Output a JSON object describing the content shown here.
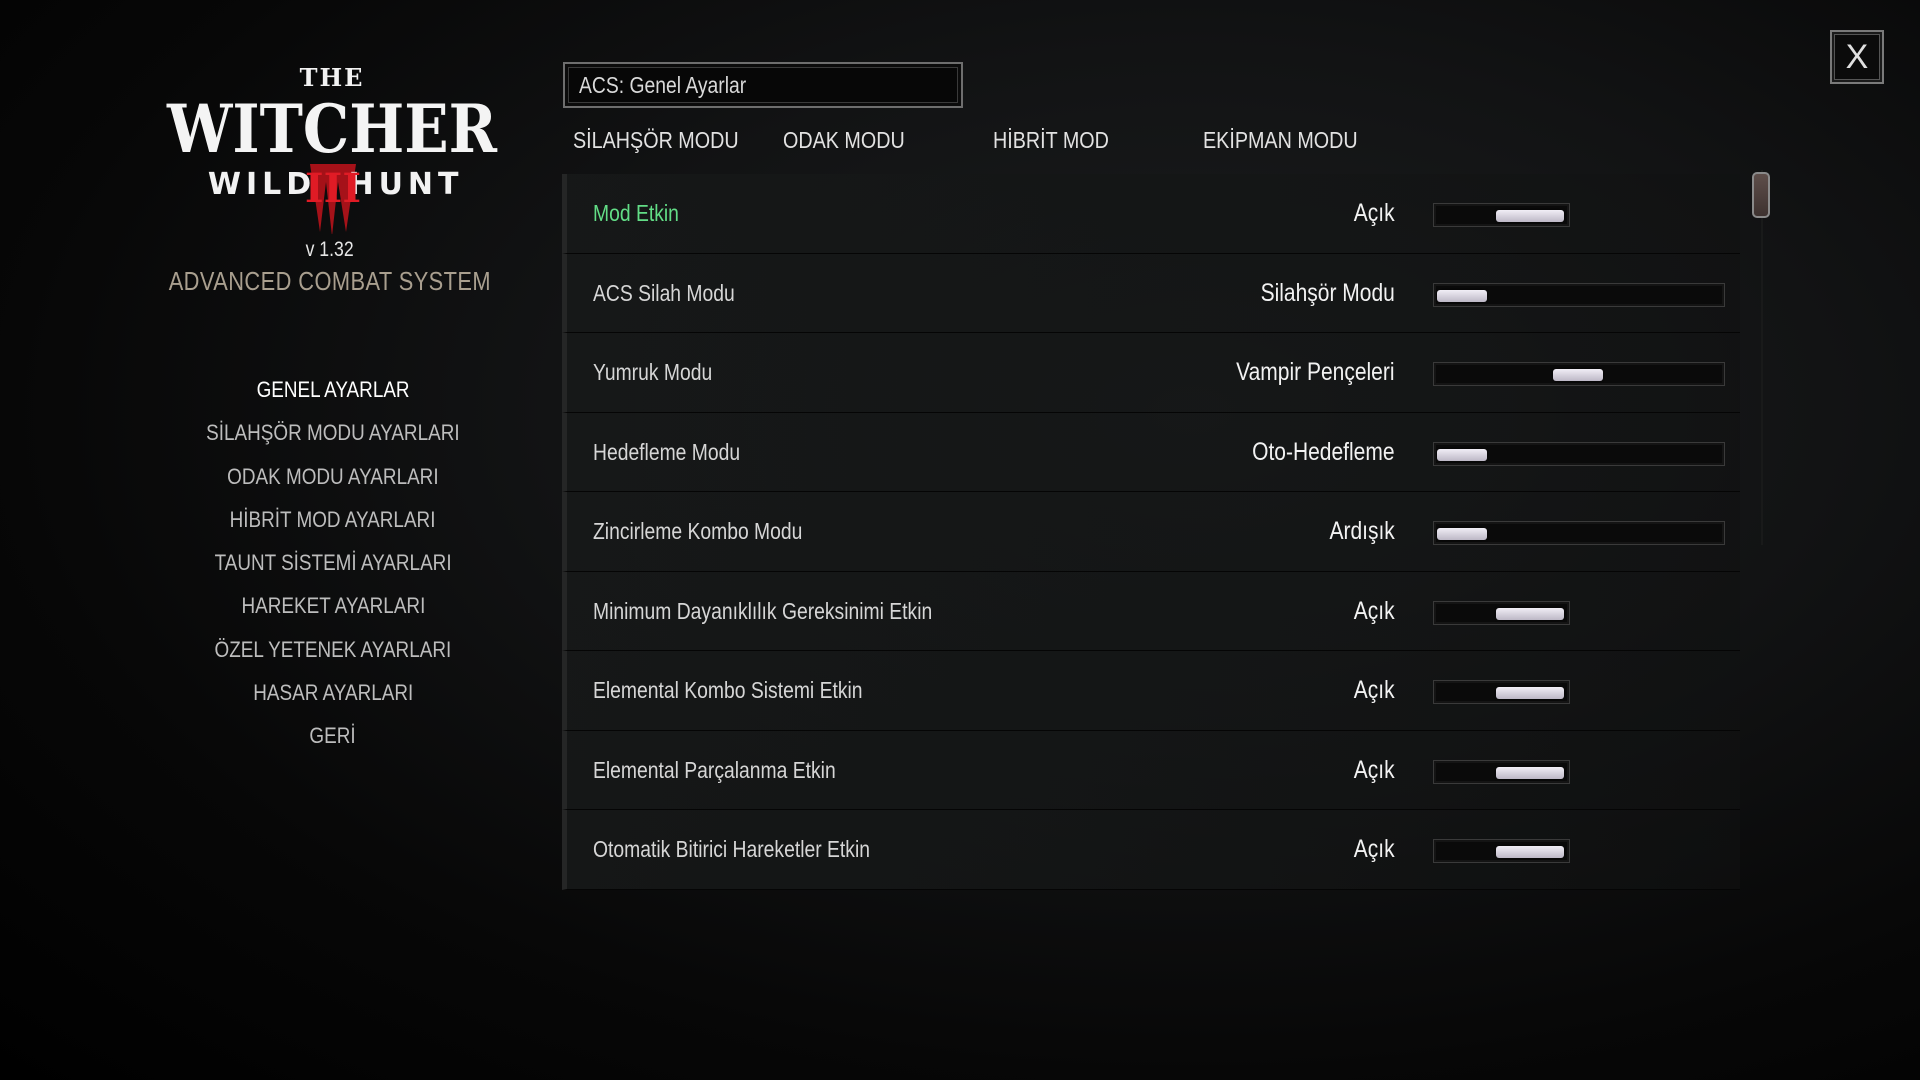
{
  "game": {
    "logo_the": "THE",
    "logo_name": "WITCHER",
    "logo_left": "WILD",
    "logo_right": "HUNT",
    "logo_numeral": "III",
    "version": "v 1.32",
    "mod_title": "ADVANCED COMBAT SYSTEM"
  },
  "sidebar": {
    "items": [
      {
        "label": "GENEL AYARLAR",
        "active": true
      },
      {
        "label": "SİLAHŞÖR MODU AYARLARI"
      },
      {
        "label": "ODAK MODU AYARLARI"
      },
      {
        "label": "HİBRİT MOD AYARLARI"
      },
      {
        "label": "TAUNT SİSTEMİ AYARLARI"
      },
      {
        "label": "HAREKET AYARLARI"
      },
      {
        "label": "ÖZEL YETENEK AYARLARI"
      },
      {
        "label": "HASAR AYARLARI"
      },
      {
        "label": "GERİ"
      }
    ]
  },
  "header": {
    "section_title": "ACS: Genel Ayarlar",
    "tabs": [
      "SİLAHŞÖR MODU",
      "ODAK MODU",
      "HİBRİT MOD",
      "EKİPMAN MODU"
    ]
  },
  "close_label": "X",
  "settings": [
    {
      "label": "Mod Etkin",
      "value": "Açık",
      "slider": "toggle",
      "position": 1,
      "highlight": true
    },
    {
      "label": "ACS Silah Modu",
      "value": "Silahşör Modu",
      "slider": "options",
      "position": 0
    },
    {
      "label": "Yumruk Modu",
      "value": "Vampir Pençeleri",
      "slider": "options",
      "position": 0.5
    },
    {
      "label": "Hedefleme Modu",
      "value": "Oto-Hedefleme",
      "slider": "options",
      "position": 0
    },
    {
      "label": "Zincirleme Kombo Modu",
      "value": "Ardışık",
      "slider": "options",
      "position": 0
    },
    {
      "label": "Minimum Dayanıklılık Gereksinimi Etkin",
      "value": "Açık",
      "slider": "toggle",
      "position": 1
    },
    {
      "label": "Elemental Kombo Sistemi Etkin",
      "value": "Açık",
      "slider": "toggle",
      "position": 1
    },
    {
      "label": "Elemental Parçalanma Etkin",
      "value": "Açık",
      "slider": "toggle",
      "position": 1
    },
    {
      "label": "Otomatik Bitirici Hareketler Etkin",
      "value": "Açık",
      "slider": "toggle",
      "position": 1
    }
  ],
  "colors": {
    "highlight": "#62dd86",
    "subtitle": "#a99f8f",
    "knob": "#d9d5df"
  }
}
